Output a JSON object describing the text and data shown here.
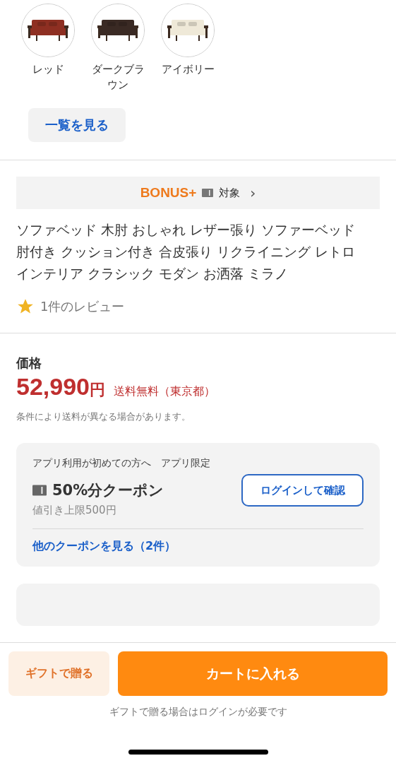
{
  "variants": [
    {
      "label": "レッド",
      "color": "#8e2f22"
    },
    {
      "label": "ダークブラウン",
      "color": "#3a2a24"
    },
    {
      "label": "アイボリー",
      "color": "#efe9d8"
    }
  ],
  "view_all": "一覧を見る",
  "bonus": {
    "logo": "BONUS+",
    "label": "対象",
    "chevron": "›"
  },
  "title": "ソファベッド 木肘 おしゃれ レザー張り ソファーベッド肘付き クッション付き 合皮張り リクライニング レトロインテリア クラシック モダン お洒落 ミラノ",
  "review": {
    "text": "1件のレビュー"
  },
  "price": {
    "label": "価格",
    "amount": "52,990",
    "currency": "円",
    "shipping": "送料無料（東京都）",
    "note": "条件により送料が異なる場合があります。"
  },
  "coupon": {
    "audience": "アプリ利用が初めての方へ　アプリ限定",
    "title": "50%分クーポン",
    "limit": "値引き上限500円",
    "button": "ログインして確認",
    "more": "他のクーポンを見る（2件）"
  },
  "bottom": {
    "gift": "ギフトで贈る",
    "cart": "カートに入れる",
    "note": "ギフトで贈る場合はログインが必要です"
  }
}
